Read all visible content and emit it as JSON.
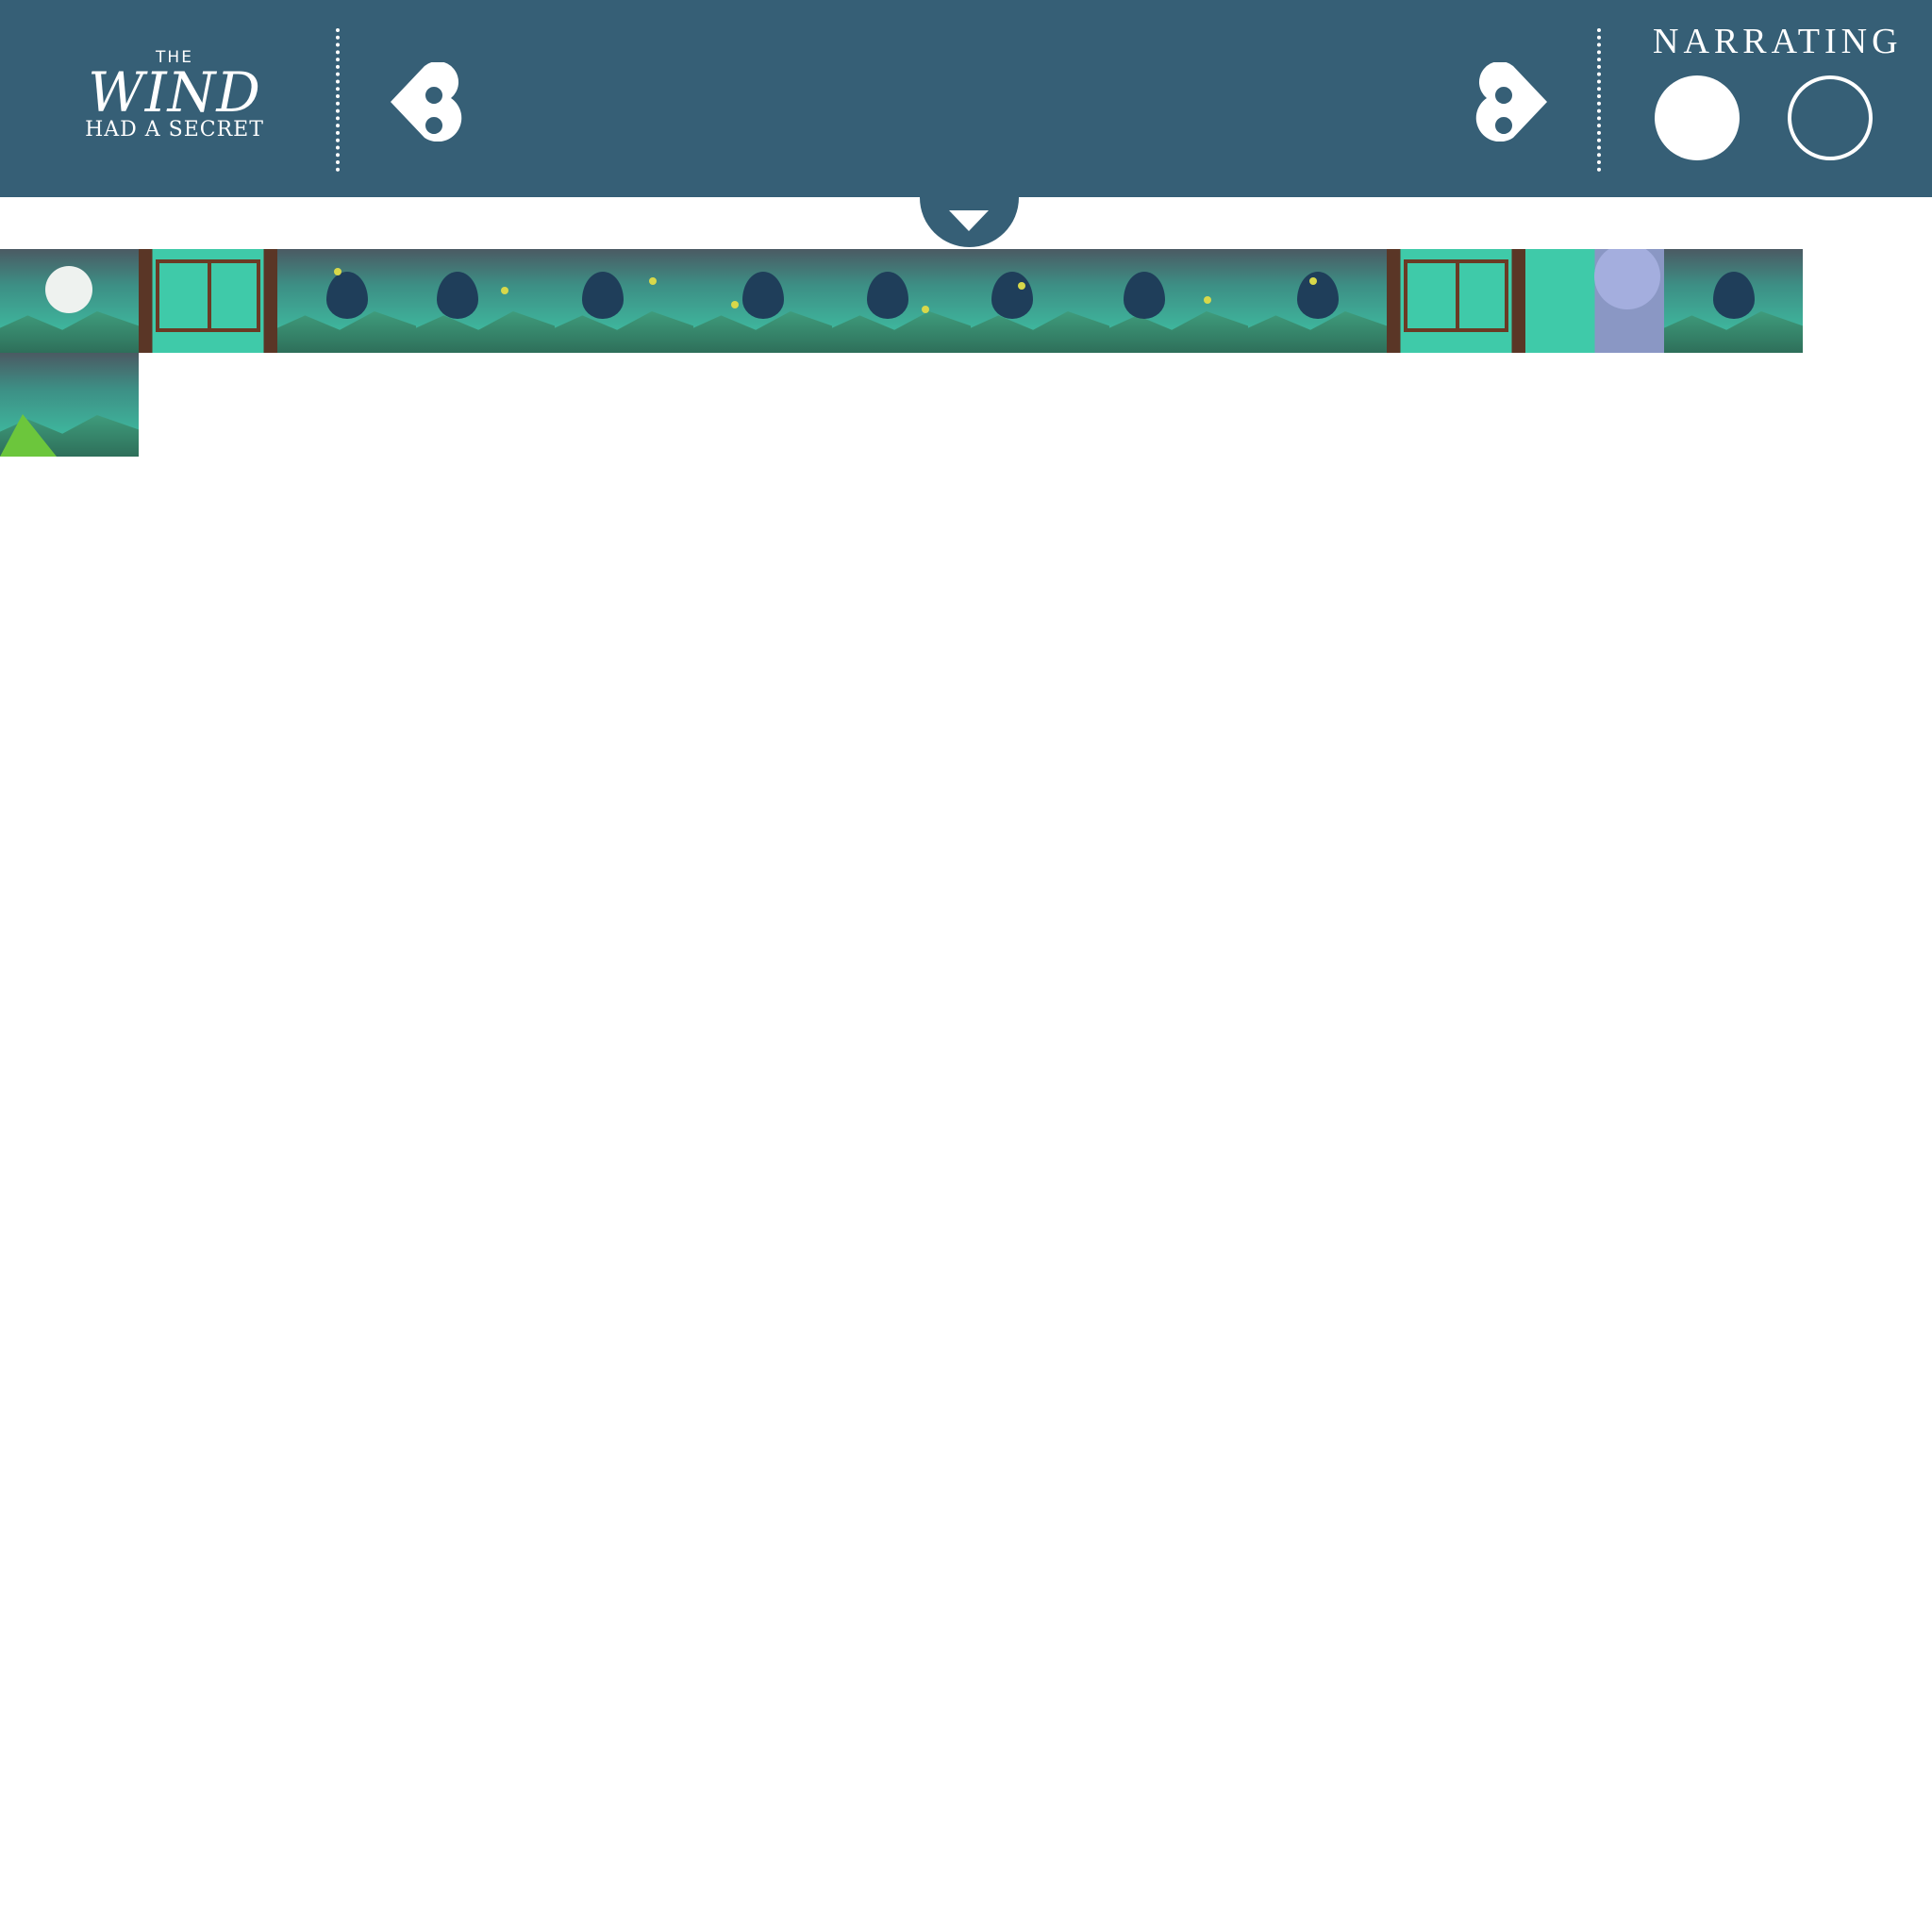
{
  "app": {
    "logo_the": "THE",
    "logo_wind": "WIND",
    "logo_sub": "HAD A SECRET"
  },
  "header": {
    "narrating_label": "NARRATING"
  },
  "icons": {
    "prev": "heart-arrow-left-icon",
    "next": "heart-arrow-right-icon",
    "pull_tab": "chevron-down-icon"
  },
  "colors": {
    "header_bg": "#365f76",
    "accent": "#3fcaa9",
    "icon": "#ffffff"
  },
  "narrating_toggle": {
    "on_selected": true
  },
  "thumbnails": [
    {
      "page": 1,
      "variant": "cover"
    },
    {
      "page": 2,
      "variant": "window"
    },
    {
      "page": 3,
      "variant": "motif"
    },
    {
      "page": 4,
      "variant": "motif"
    },
    {
      "page": 5,
      "variant": "motif"
    },
    {
      "page": 6,
      "variant": "motif"
    },
    {
      "page": 7,
      "variant": "motif"
    },
    {
      "page": 8,
      "variant": "motif"
    },
    {
      "page": 9,
      "variant": "motif"
    },
    {
      "page": 10,
      "variant": "motif"
    },
    {
      "page": 11,
      "variant": "window"
    },
    {
      "page": 12,
      "variant": "moon"
    },
    {
      "page": 13,
      "variant": "motif"
    },
    {
      "page": 14,
      "variant": "end"
    }
  ]
}
